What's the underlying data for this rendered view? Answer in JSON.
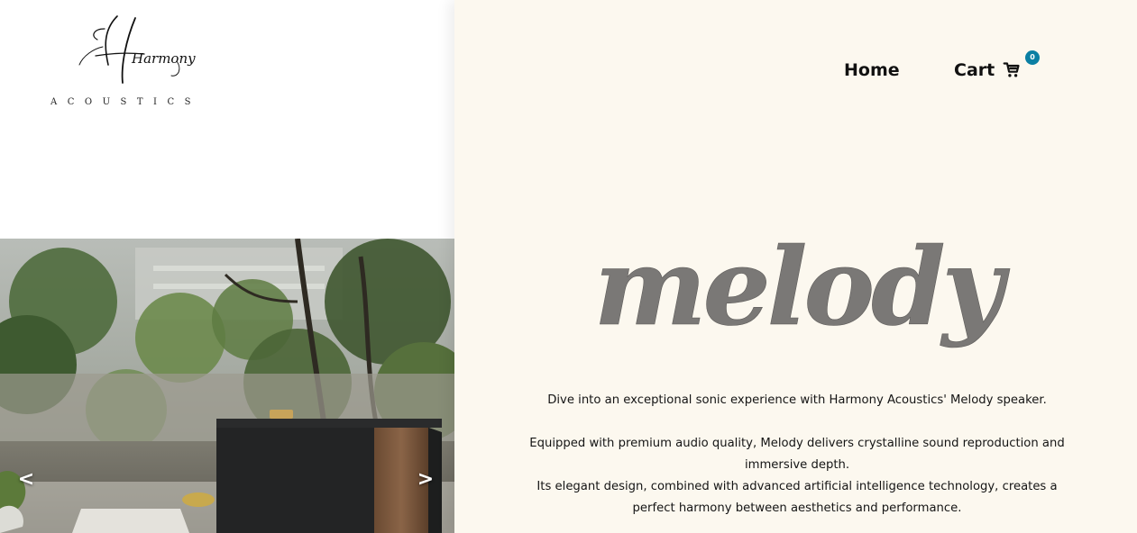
{
  "brand": {
    "script_name": "Harmony",
    "subtitle": "ACOUSTICS"
  },
  "nav": {
    "home_label": "Home",
    "cart_label": "Cart",
    "cart_count": "0",
    "cart_icon": "shopping-cart-icon"
  },
  "slider": {
    "prev_label": "<",
    "next_label": ">"
  },
  "hero": {
    "title": "melody",
    "paragraph1": "Dive into an exceptional sonic experience with Harmony Acoustics' Melody speaker.",
    "paragraph2": "Equipped with premium audio quality, Melody delivers crystalline sound reproduction and immersive depth.",
    "paragraph3": "Its elegant design, combined with advanced artificial intelligence technology, creates a perfect harmony between aesthetics and performance."
  },
  "colors": {
    "right_panel_bg": "#fcf8ef",
    "title_gray": "#7a7876",
    "badge_blue": "#0b7fa3",
    "text_dark": "#111111"
  }
}
